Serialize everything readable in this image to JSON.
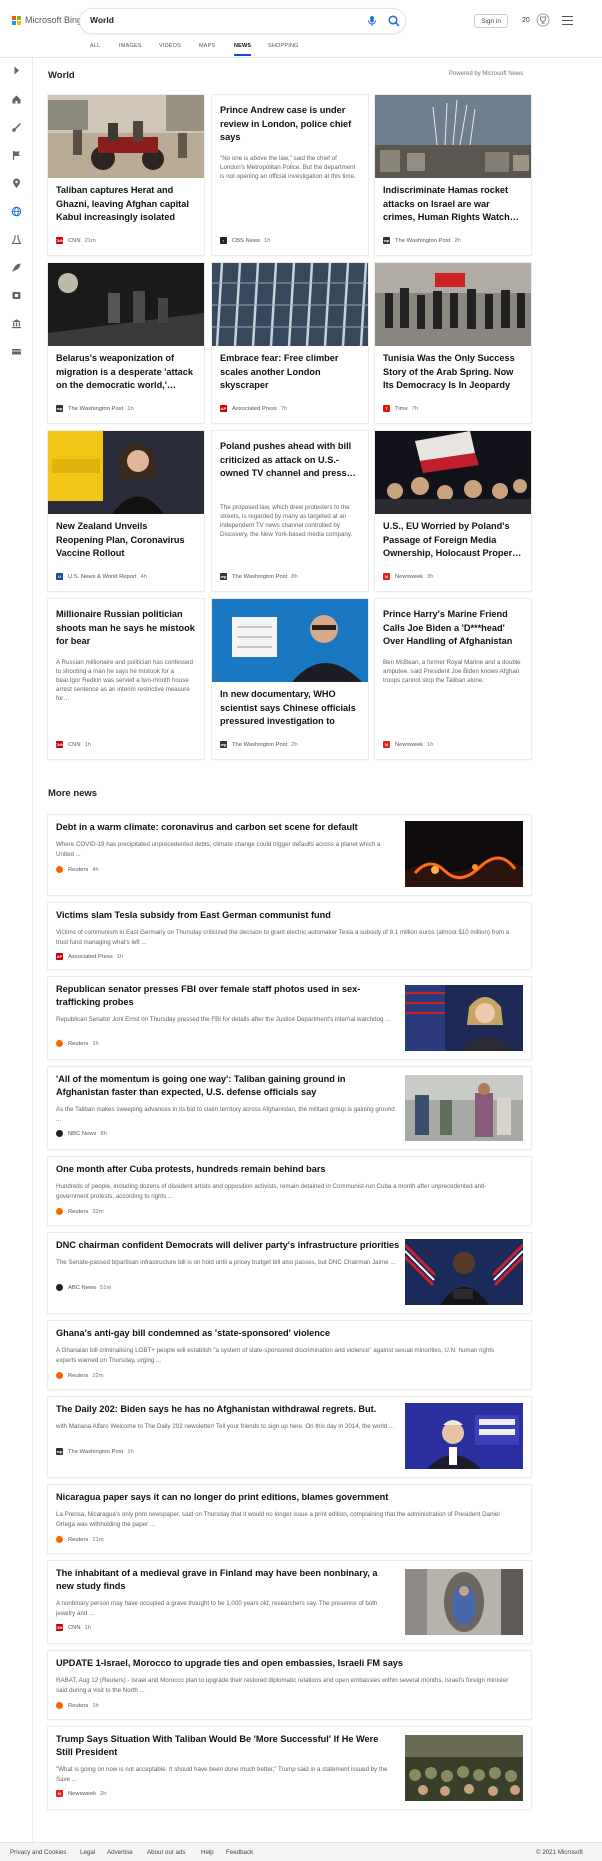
{
  "brand": {
    "name": "Microsoft Bing",
    "logo_colors": [
      "#f25022",
      "#7fba00",
      "#00a4ef",
      "#ffb900"
    ]
  },
  "search": {
    "query": "World"
  },
  "account": {
    "signin_label": "Sign in",
    "rewards_count": "20"
  },
  "tabs": [
    {
      "label": "ALL"
    },
    {
      "label": "IMAGES"
    },
    {
      "label": "VIDEOS"
    },
    {
      "label": "MAPS"
    },
    {
      "label": "NEWS",
      "active": true
    },
    {
      "label": "SHOPPING"
    }
  ],
  "rail_icons": [
    "expand-arrow-icon",
    "home-icon",
    "sports-icon",
    "flag-icon",
    "map-pin-icon",
    "globe-icon",
    "science-icon",
    "rocket-icon",
    "movies-icon",
    "bank-icon",
    "money-icon"
  ],
  "section": {
    "title": "World",
    "powered_by": "Powered by Microsoft News"
  },
  "cards": [
    {
      "title": "Taliban captures Herat and Ghazni, leaving Afghan capital Kabul increasingly isolated",
      "source": "CNN",
      "time": "21m",
      "source_color": "#cc0000",
      "has_image": true
    },
    {
      "title": "Prince Andrew case is under review in London, police chief says",
      "desc": "\"No one is above the law,\" said the chief of London's Metropolitan Police. But the department is not opening an official investigation at this time.",
      "source": "CBS News",
      "time": "1h",
      "source_color": "#222222",
      "has_image": false
    },
    {
      "title": "Indiscriminate Hamas rocket attacks on Israel are war crimes, Human Rights Watch…",
      "source": "The Washington Post",
      "time": "2h",
      "source_color": "#333333",
      "has_image": true
    },
    {
      "title": "Belarus's weaponization of migration is a desperate 'attack on the democratic world,'…",
      "source": "The Washington Post",
      "time": "1h",
      "source_color": "#333333",
      "has_image": true
    },
    {
      "title": "Embrace fear: Free climber scales another London skyscraper",
      "source": "Associated Press",
      "time": "7h",
      "source_color": "#cc0000",
      "has_image": true
    },
    {
      "title": "Tunisia Was the Only Success Story of the Arab Spring. Now Its Democracy Is In Jeopardy",
      "source": "Time",
      "time": "7h",
      "source_color": "#e3120b",
      "has_image": true
    },
    {
      "title": "New Zealand Unveils Reopening Plan, Coronavirus Vaccine Rollout",
      "source": "U.S. News & World Report",
      "time": "4h",
      "source_color": "#1a4b9c",
      "has_image": true
    },
    {
      "title": "Poland pushes ahead with bill criticized as attack on U.S.-owned TV channel and press…",
      "desc": "The proposed law, which drew protesters to the streets, is regarded by many as targeted at an independent TV news channel controlled by Discovery, the New York-based media company.",
      "source": "The Washington Post",
      "time": "8h",
      "source_color": "#333333",
      "has_image": false
    },
    {
      "title": "U.S., EU Worried by Poland's Passage of Foreign Media Ownership, Holocaust Proper…",
      "source": "Newsweek",
      "time": "3h",
      "source_color": "#e2231a",
      "has_image": true
    },
    {
      "title": "Millionaire Russian politician shoots man he says he mistook for bear",
      "desc": "A Russian millionaire and politician has confessed to shooting a man he says he mistook for a bear.Igor Redkin was served a two-month house arrest sentence as an interim restrictive measure for…",
      "source": "CNN",
      "time": "1h",
      "source_color": "#cc0000",
      "has_image": false
    },
    {
      "title": "In new documentary, WHO scientist says Chinese officials pressured investigation to dro…",
      "source": "The Washington Post",
      "time": "2h",
      "source_color": "#333333",
      "has_image": true
    },
    {
      "title": "Prince Harry's Marine Friend Calls Joe Biden a 'D***head' Over Handling of Afghanistan",
      "desc": "Ben McBean, a former Royal Marine and a double amputee, said President Joe Biden knows Afghan troops cannot stop the Taliban alone.",
      "source": "Newsweek",
      "time": "1h",
      "source_color": "#e2231a",
      "has_image": false
    }
  ],
  "more_news": {
    "title": "More news",
    "items": [
      {
        "title": "Debt in a warm climate: coronavirus and carbon set scene for default",
        "desc": "Where COVID-19 has precipitated unprecedented debts, climate change could trigger defaults across a planet which a United ...",
        "source": "Reuters",
        "time": "4h",
        "source_color": "#fa6400",
        "thumb": "fire"
      },
      {
        "title": "Victims slam Tesla subsidy from East German communist fund",
        "desc": "Victims of communism in East Germany on Thursday criticized the decision to grant electric automaker Tesla a subsidy of 8.1 million euros (almost $10 million) from a trust fund managing what's left ...",
        "source": "Associated Press",
        "time": "1h",
        "source_color": "#cc0000",
        "thumb": ""
      },
      {
        "title": "Republican senator presses FBI over female staff photos used in sex-trafficking probes",
        "desc": "Republican Senator Joni Ernst on Thursday pressed the FBI for details after the Justice Department's internal watchdog ...",
        "source": "Reuters",
        "time": "1h",
        "source_color": "#fa6400",
        "thumb": "senator"
      },
      {
        "title": "'All of the momentum is going one way': Taliban gaining ground in Afghanistan faster than expected, U.S. defense officials say",
        "desc": "As the Taliban makes sweeping advances in its bid to claim territory across Afghanistan, the militant group is gaining ground ...",
        "source": "NBC News",
        "time": "8h",
        "source_color": "#222222",
        "thumb": "afghan"
      },
      {
        "title": "One month after Cuba protests, hundreds remain behind bars",
        "desc": "Hundreds of people, including dozens of dissident artists and opposition activists, remain detained in Communist-run Cuba a month after unprecedented anti-government protests, according to rights ...",
        "source": "Reuters",
        "time": "32m",
        "source_color": "#fa6400",
        "thumb": ""
      },
      {
        "title": "DNC chairman confident Democrats will deliver party's infrastructure priorities",
        "desc": "The Senate-passed bipartisan infrastructure bill is on hold until a pricey budget bill also passes, but DNC Chairman Jaime ...",
        "source": "ABC News",
        "time": "51m",
        "source_color": "#222222",
        "thumb": "dnc"
      },
      {
        "title": "Ghana's anti-gay bill condemned as 'state-sponsored' violence",
        "desc": "A Ghanaian bill criminalising LGBT+ people will establish \"a system of state-sponsored discrimination and violence\" against sexual minorities, U.N. human rights experts warned on Thursday, urging ...",
        "source": "Reuters",
        "time": "22m",
        "source_color": "#fa6400",
        "thumb": ""
      },
      {
        "title": "The Daily 202: Biden says he has no Afghanistan withdrawal regrets. But.",
        "desc": "with Mariana Alfaro Welcome to The Daily 202 newsletter! Tell your friends to sign up here. On this day in 2014, the world ...",
        "source": "The Washington Post",
        "time": "1h",
        "source_color": "#333333",
        "thumb": "biden"
      },
      {
        "title": "Nicaragua paper says it can no longer do print editions, blames government",
        "desc": "La Prensa, Nicaragua's only print newspaper, said on Thursday that it would no longer issue a print edition, complaining that the administration of President Daniel Ortega was withholding the paper ...",
        "source": "Reuters",
        "time": "21m",
        "source_color": "#fa6400",
        "thumb": ""
      },
      {
        "title": "The inhabitant of a medieval grave in Finland may have been nonbinary, a new study finds",
        "desc": "A nonbinary person may have occupied a grave thought to be 1,000 years old, researchers say. The presence of both jewelry and ...",
        "source": "CNN",
        "time": "1h",
        "source_color": "#cc0000",
        "thumb": "grave"
      },
      {
        "title": "UPDATE 1-Israel, Morocco to upgrade ties and open embassies, Israeli FM says",
        "desc": "RABAT, Aug 12 (Reuters) - Israel and Morocco plan to upgrade their restored diplomatic relations and open embassies within several months, Israel's foreign minister said during a visit to the North ...",
        "source": "Reuters",
        "time": "1h",
        "source_color": "#fa6400",
        "thumb": ""
      },
      {
        "title": "Trump Says Situation With Taliban Would Be 'More Successful' If He Were Still President",
        "desc": "\"What is going on now is not acceptable. It should have been done much better,\" Trump said in a statement issued by the Save ...",
        "source": "Newsweek",
        "time": "2h",
        "source_color": "#e2231a",
        "thumb": "trump"
      }
    ]
  },
  "footer": {
    "links": [
      "Privacy and Cookies",
      "Legal",
      "Advertise",
      "About our ads",
      "Help",
      "Feedback"
    ],
    "copyright": "© 2021 Microsoft"
  }
}
